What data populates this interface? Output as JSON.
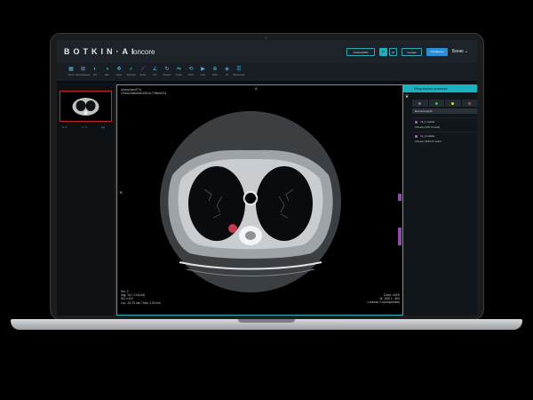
{
  "app": {
    "logo": "BOTKIN·AI",
    "product": "oncore",
    "header_buttons": [
      "Снимок(ИИ)",
      "1/1",
      "Ø",
      "Снимки",
      "Сохранить"
    ],
    "user": "Беню",
    "accent": "#1ab1c1",
    "frame_highlight": "#2fb4c2"
  },
  "toolbar": {
    "items": [
      {
        "icon": "grid-icon",
        "glyph": "▦",
        "label": "Серии"
      },
      {
        "icon": "layout-icon",
        "glyph": "⊞",
        "label": "Расположение"
      },
      {
        "icon": "contrast-icon",
        "glyph": "◐",
        "label": "W/L"
      },
      {
        "icon": "colormap-icon",
        "glyph": "◑",
        "label": "Цвет"
      },
      {
        "icon": "move-icon",
        "glyph": "✥",
        "label": "Сдвиг"
      },
      {
        "icon": "zoom-icon",
        "glyph": "⌕",
        "label": "Масштаб"
      },
      {
        "icon": "ruler-icon",
        "glyph": "⟋",
        "label": "Длина"
      },
      {
        "icon": "angle-icon",
        "glyph": "∠",
        "label": "Угол"
      },
      {
        "icon": "rotate-icon",
        "glyph": "↻",
        "label": "Поворот"
      },
      {
        "icon": "flip-icon",
        "glyph": "⇋",
        "label": "Отраж."
      },
      {
        "icon": "reset-icon",
        "glyph": "⟲",
        "label": "Сброс"
      },
      {
        "icon": "cine-icon",
        "glyph": "▶",
        "label": "Кино"
      },
      {
        "icon": "mpr-icon",
        "glyph": "⊕",
        "label": "MPR"
      },
      {
        "icon": "3d-icon",
        "glyph": "◈",
        "label": "3D"
      },
      {
        "icon": "report-icon",
        "glyph": "☰",
        "label": "Заключение"
      }
    ]
  },
  "thumbnails": [
    {
      "label_left": "S: 2",
      "label_right": "1 / 1",
      "badge": "Сд"
    }
  ],
  "viewer": {
    "top_left": [
      "Anonymized774",
      "1Pat1d:bb5a9d9-b5ff-4c77f6bb0d7a"
    ],
    "bottom_left": [
      "Ser: 2",
      "Img: 114 / 114(144)",
      "512 x 512",
      "Loc: -50.75 mm Thick: 2.50 mm"
    ],
    "bottom_right": [
      "Zoom: 163%",
      "W: 1500 L: -600",
      "Lossless / Uncompressed"
    ],
    "orientation": {
      "top": "A",
      "left": "R"
    },
    "nodule_color": "#e0455a"
  },
  "results": {
    "title": "Результаты анализа",
    "swatch_colors": [
      "#b04cc2",
      "#35c14a",
      "#e5d62a",
      "#e03a3a"
    ],
    "selected_label": "Без категорий",
    "nodules": [
      {
        "name": "ml_1 nodule",
        "volume": "Объем (195.72 мм3)"
      },
      {
        "name": "ml_2 nodule",
        "volume": "Объем (1195.37 мм3)"
      }
    ]
  }
}
